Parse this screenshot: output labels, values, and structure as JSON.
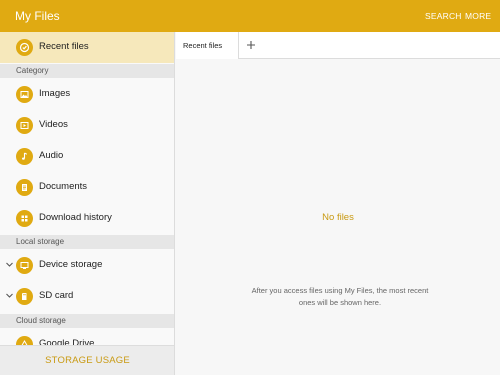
{
  "app": {
    "title": "My Files",
    "actions": {
      "search": "SEARCH",
      "more": "MORE"
    }
  },
  "sidebar": {
    "recent": {
      "label": "Recent files",
      "icon": "clock-icon"
    },
    "sections": {
      "category": "Category",
      "local": "Local storage",
      "cloud": "Cloud storage"
    },
    "category_items": [
      {
        "label": "Images",
        "icon": "image-icon"
      },
      {
        "label": "Videos",
        "icon": "video-icon"
      },
      {
        "label": "Audio",
        "icon": "music-note-icon"
      },
      {
        "label": "Documents",
        "icon": "document-icon"
      },
      {
        "label": "Download history",
        "icon": "download-icon"
      }
    ],
    "local_items": [
      {
        "label": "Device storage",
        "icon": "device-icon"
      },
      {
        "label": "SD card",
        "icon": "sd-card-icon"
      }
    ],
    "cloud_items": [
      {
        "label": "Google Drive",
        "icon": "google-drive-icon"
      }
    ],
    "storage_usage": "STORAGE USAGE"
  },
  "main": {
    "tabs": [
      {
        "label": "Recent files"
      }
    ],
    "empty": {
      "title": "No files",
      "message": "After you access files using My Files, the most recent ones will be shown here."
    }
  },
  "colors": {
    "accent": "#e0aa12",
    "active_row": "#f6e8bb",
    "accent_text": "#c99a12"
  }
}
